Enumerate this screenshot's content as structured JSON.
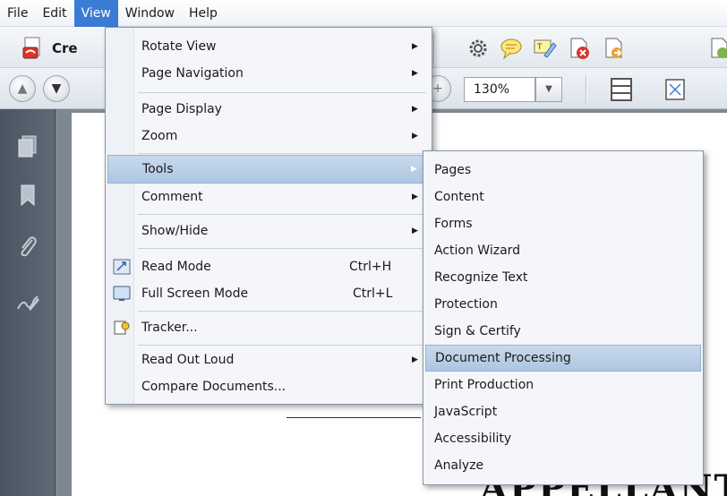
{
  "menubar": {
    "items": [
      "File",
      "Edit",
      "View",
      "Window",
      "Help"
    ]
  },
  "toolbar": {
    "create_label": "Cre",
    "zoom_value": "130%",
    "tool_icons": [
      "gear-icon",
      "comment-icon",
      "highlight-icon",
      "delete-page-icon",
      "export-page-icon",
      "page-icon"
    ]
  },
  "view_menu": {
    "items": [
      {
        "label": "Rotate View",
        "submenu": true
      },
      {
        "label": "Page Navigation",
        "submenu": true
      },
      {
        "label": "Page Display",
        "submenu": true
      },
      {
        "label": "Zoom",
        "submenu": true
      },
      {
        "label": "Tools",
        "submenu": true,
        "highlighted": true
      },
      {
        "label": "Comment",
        "submenu": true
      },
      {
        "label": "Show/Hide",
        "submenu": true
      },
      {
        "label": "Read Mode",
        "shortcut": "Ctrl+H",
        "icon": "read-mode-icon"
      },
      {
        "label": "Full Screen Mode",
        "shortcut": "Ctrl+L",
        "icon": "full-screen-icon"
      },
      {
        "label": "Tracker...",
        "icon": "tracker-icon"
      },
      {
        "label": "Read Out Loud",
        "submenu": true
      },
      {
        "label": "Compare Documents..."
      }
    ]
  },
  "tools_submenu": {
    "items": [
      {
        "label": "Pages"
      },
      {
        "label": "Content"
      },
      {
        "label": "Forms"
      },
      {
        "label": "Action Wizard"
      },
      {
        "label": "Recognize Text"
      },
      {
        "label": "Protection"
      },
      {
        "label": "Sign & Certify"
      },
      {
        "label": "Document Processing",
        "highlighted": true
      },
      {
        "label": "Print Production"
      },
      {
        "label": "JavaScript"
      },
      {
        "label": "Accessibility"
      },
      {
        "label": "Analyze"
      }
    ]
  },
  "document": {
    "visible_text": "APPELLANT"
  },
  "colors": {
    "menu_highlight": "#aec6e2",
    "menubar_active": "#3a7bd5",
    "sidebar": "#4b5561"
  }
}
